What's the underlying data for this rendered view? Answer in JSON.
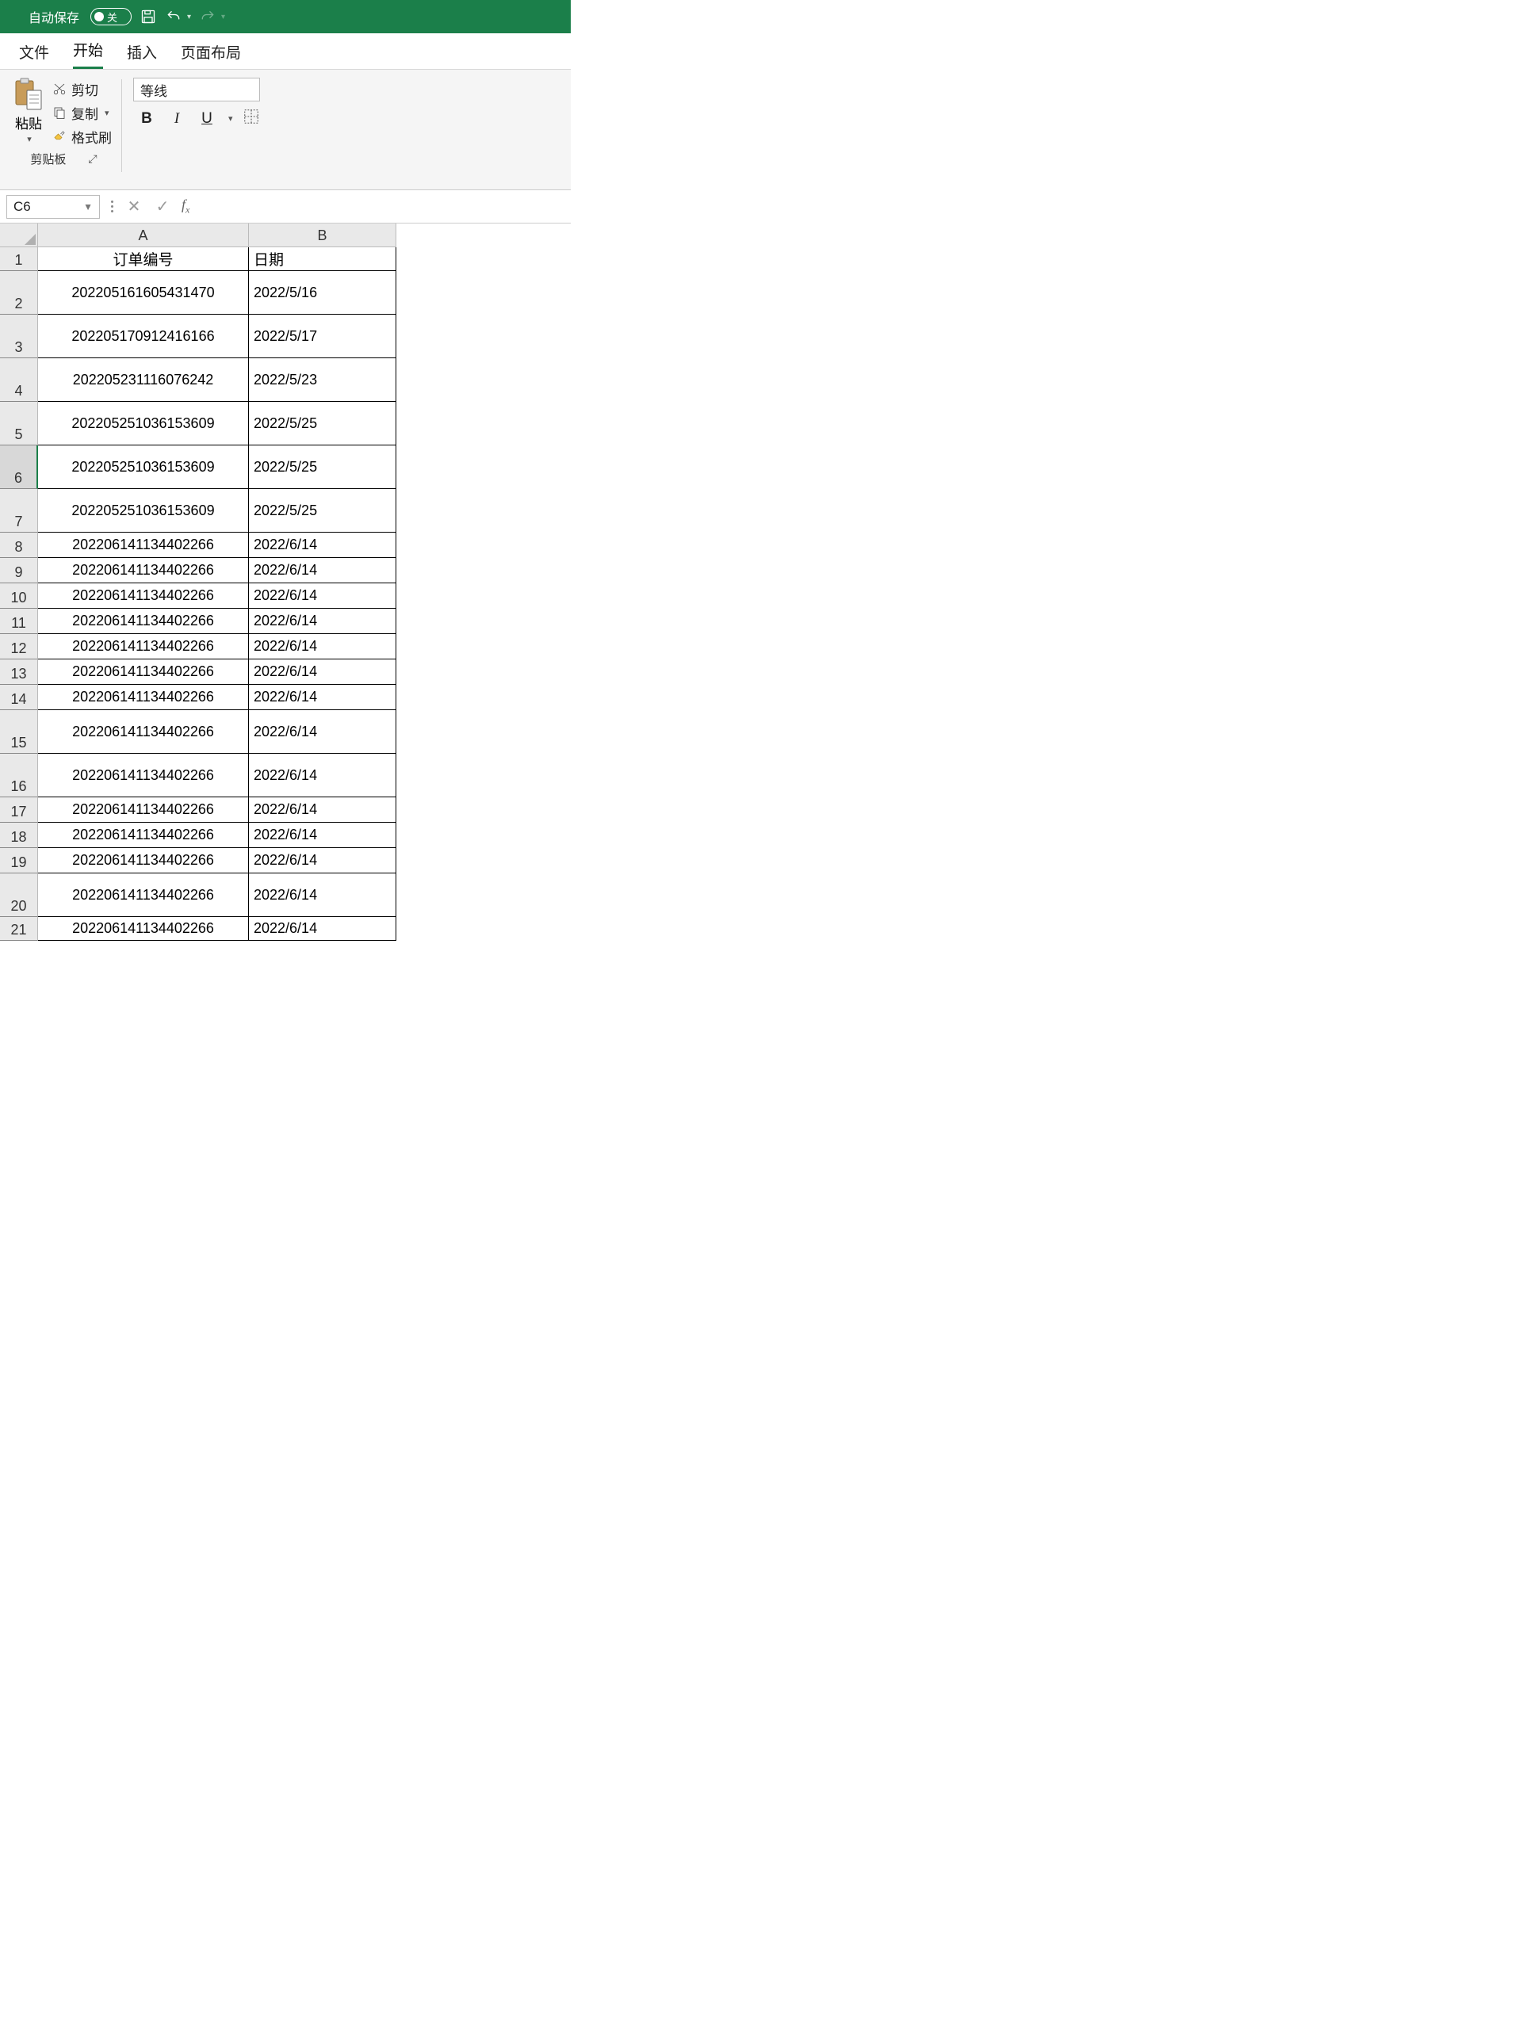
{
  "titlebar": {
    "autosave_label": "自动保存",
    "autosave_state": "关"
  },
  "tabs": {
    "file": "文件",
    "home": "开始",
    "insert": "插入",
    "page_layout": "页面布局"
  },
  "clipboard": {
    "paste": "粘贴",
    "cut": "剪切",
    "copy": "复制",
    "format_painter": "格式刷",
    "group_label": "剪贴板"
  },
  "font": {
    "name": "等线",
    "bold": "B",
    "italic": "I",
    "underline": "U"
  },
  "namebox": {
    "cell_ref": "C6"
  },
  "formula_bar": {
    "fx": "fx"
  },
  "columns": {
    "A": "A",
    "B": "B"
  },
  "headers": {
    "colA": "订单编号",
    "colB": "日期"
  },
  "selected_row": 6,
  "rows": [
    {
      "n": 1,
      "h": 30,
      "a": "订单编号",
      "b": "日期",
      "hdr": true
    },
    {
      "n": 2,
      "h": 55,
      "a": "202205161605431470",
      "b": "2022/5/16"
    },
    {
      "n": 3,
      "h": 55,
      "a": "202205170912416166",
      "b": "2022/5/17"
    },
    {
      "n": 4,
      "h": 55,
      "a": "202205231116076242",
      "b": "2022/5/23"
    },
    {
      "n": 5,
      "h": 55,
      "a": "202205251036153609",
      "b": "2022/5/25"
    },
    {
      "n": 6,
      "h": 55,
      "a": "202205251036153609",
      "b": "2022/5/25"
    },
    {
      "n": 7,
      "h": 55,
      "a": "202205251036153609",
      "b": "2022/5/25"
    },
    {
      "n": 8,
      "h": 32,
      "a": "202206141134402266",
      "b": "2022/6/14"
    },
    {
      "n": 9,
      "h": 32,
      "a": "202206141134402266",
      "b": "2022/6/14"
    },
    {
      "n": 10,
      "h": 32,
      "a": "202206141134402266",
      "b": "2022/6/14"
    },
    {
      "n": 11,
      "h": 32,
      "a": "202206141134402266",
      "b": "2022/6/14"
    },
    {
      "n": 12,
      "h": 32,
      "a": "202206141134402266",
      "b": "2022/6/14"
    },
    {
      "n": 13,
      "h": 32,
      "a": "202206141134402266",
      "b": "2022/6/14"
    },
    {
      "n": 14,
      "h": 32,
      "a": "202206141134402266",
      "b": "2022/6/14"
    },
    {
      "n": 15,
      "h": 55,
      "a": "202206141134402266",
      "b": "2022/6/14"
    },
    {
      "n": 16,
      "h": 55,
      "a": "202206141134402266",
      "b": "2022/6/14"
    },
    {
      "n": 17,
      "h": 32,
      "a": "202206141134402266",
      "b": "2022/6/14"
    },
    {
      "n": 18,
      "h": 32,
      "a": "202206141134402266",
      "b": "2022/6/14"
    },
    {
      "n": 19,
      "h": 32,
      "a": "202206141134402266",
      "b": "2022/6/14"
    },
    {
      "n": 20,
      "h": 55,
      "a": "202206141134402266",
      "b": "2022/6/14"
    },
    {
      "n": 21,
      "h": 30,
      "a": "202206141134402266",
      "b": "2022/6/14"
    }
  ]
}
